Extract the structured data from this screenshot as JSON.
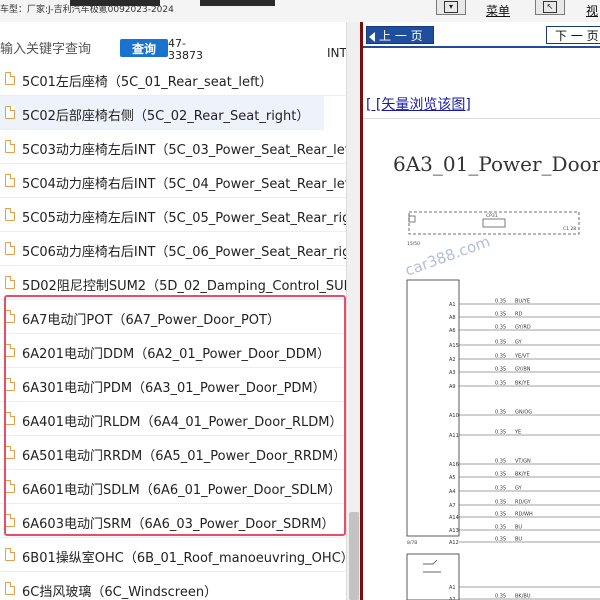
{
  "app": {
    "vehicle_label": "车型：厂家:J-吉利汽车极氪0092023-2024",
    "menu_label": "菜单",
    "view_label": "视"
  },
  "search": {
    "placeholder": "输入关键字查询",
    "button_label": "查询",
    "result_count": "47-33873",
    "int_label": "INT"
  },
  "doc_list": [
    {
      "label": "5C01左后座椅（5C_01_Rear_seat_left）"
    },
    {
      "label": "5C02后部座椅右侧（5C_02_Rear_Seat_right）"
    },
    {
      "label": "5C03动力座椅左后INT（5C_03_Power_Seat_Rear_left_"
    },
    {
      "label": "5C04动力座椅右后INT（5C_04_Power_Seat_Rear_left_"
    },
    {
      "label": "5C05动力座椅左后INT（5C_05_Power_Seat_Rear_righ"
    },
    {
      "label": "5C06动力座椅右后INT（5C_06_Power_Seat_Rear_righ"
    },
    {
      "label": "5D02阻尼控制SUM2（5D_02_Damping_Control_SUM"
    },
    {
      "label": "6A7电动门POT（6A7_Power_Door_POT）"
    },
    {
      "label": "6A201电动门DDM（6A2_01_Power_Door_DDM）"
    },
    {
      "label": "6A301电动门PDM（6A3_01_Power_Door_PDM）"
    },
    {
      "label": "6A401电动门RLDM（6A4_01_Power_Door_RLDM）"
    },
    {
      "label": "6A501电动门RRDM（6A5_01_Power_Door_RRDM）"
    },
    {
      "label": "6A601电动门SDLM（6A6_01_Power_Door_SDLM）"
    },
    {
      "label": "6A603电动门SRM（6A6_03_Power_Door_SDRM）"
    },
    {
      "label": "6B01操纵室OHC（6B_01_Roof_manoeuvring_OHC）"
    },
    {
      "label": "6C挡风玻璃（6C_Windscreen）"
    }
  ],
  "viewer": {
    "prev_label": "上 一 页",
    "next_label": "下 一 页",
    "vector_link": "[ [矢量浏览该图]",
    "title": "6A3_01_Power_Door_",
    "watermark": "car388.com"
  },
  "schematic": {
    "top_connector": "CP31",
    "top_right": "C1 28",
    "left_tag_1": "15/50",
    "left_tag_2": "8/7B",
    "pins": [
      {
        "pin": "A1",
        "size": "0.35",
        "color": "BU/YE"
      },
      {
        "pin": "A8",
        "size": "0.35",
        "color": "RD"
      },
      {
        "pin": "A6",
        "size": "0.35",
        "color": "GY/RD"
      },
      {
        "pin": "A15",
        "size": "0.35",
        "color": "GY"
      },
      {
        "pin": "A2",
        "size": "0.35",
        "color": "YE/VT"
      },
      {
        "pin": "A3",
        "size": "0.35",
        "color": "GY/BN"
      },
      {
        "pin": "A9",
        "size": "0.35",
        "color": "BK/YE"
      },
      {
        "pin": "A10",
        "size": "0.35",
        "color": "GN/OG"
      },
      {
        "pin": "A11",
        "size": "0.35",
        "color": "YE"
      },
      {
        "pin": "A16",
        "size": "0.35",
        "color": "VT/GN"
      },
      {
        "pin": "A5",
        "size": "0.35",
        "color": "BK/YE"
      },
      {
        "pin": "A4",
        "size": "0.35",
        "color": "GY"
      },
      {
        "pin": "A7",
        "size": "0.35",
        "color": "RD/GY"
      },
      {
        "pin": "A14",
        "size": "0.35",
        "color": "RD/WH"
      },
      {
        "pin": "A13",
        "size": "0.35",
        "color": "BU"
      },
      {
        "pin": "A12",
        "size": "0.35",
        "color": "BU"
      }
    ],
    "bottom_pins": [
      {
        "pin": "A1",
        "size": "",
        "color": ""
      },
      {
        "pin": "A2",
        "size": "0.35",
        "color": "BK/BU"
      }
    ]
  },
  "colors": {
    "highlight": "#e84d6a",
    "search_button": "#1b73d0",
    "nav_blue": "#1f4e9c",
    "divider": "#7a0d0d"
  },
  "icons": [
    "document-icon",
    "arrow-left-icon",
    "toolbar-icon"
  ]
}
